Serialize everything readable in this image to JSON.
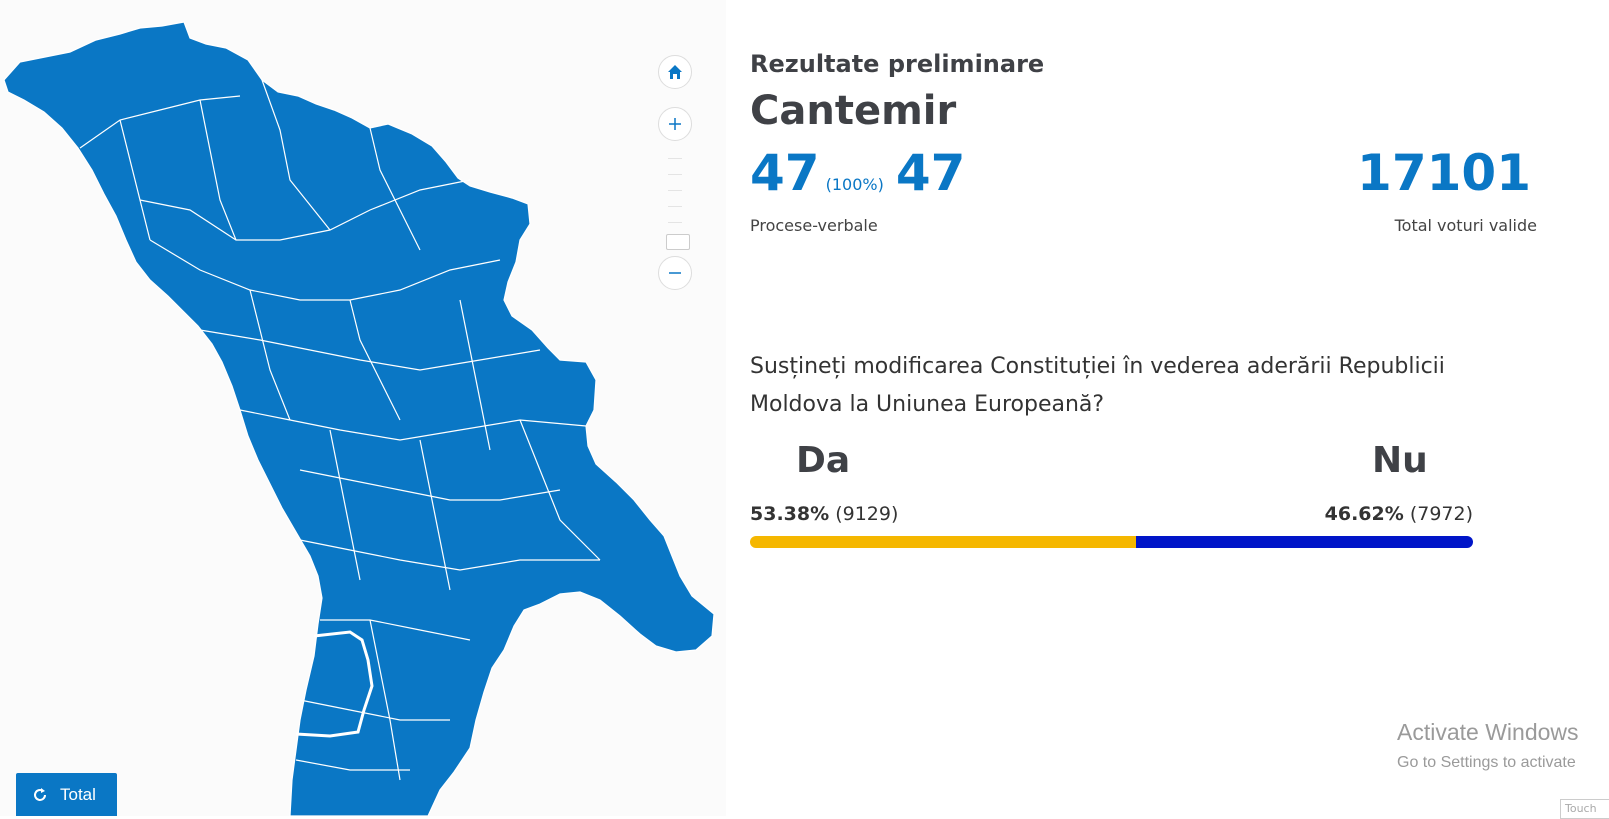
{
  "header": {
    "subtitle": "Rezultate preliminare",
    "district": "Cantemir"
  },
  "protocols": {
    "received": "47",
    "percent": "(100%)",
    "total": "47",
    "label": "Procese-verbale"
  },
  "valid_votes": {
    "value": "17101",
    "label": "Total voturi valide"
  },
  "question": "Susțineți modificarea Constituției în vederea aderării Republicii Moldova la Uniunea Europeană?",
  "answers": {
    "da": {
      "title": "Da",
      "percent_text": "53.38%",
      "count_text": "(9129)",
      "share": 53.38,
      "color": "#f5b700"
    },
    "nu": {
      "title": "Nu",
      "percent_text": "46.62%",
      "count_text": "(7972)",
      "share": 46.62,
      "color": "#0015c8"
    }
  },
  "map": {
    "fill_color": "#0a77c5",
    "border_color": "#ffffff",
    "controls": {
      "home_icon": "home-icon",
      "zoom_in_icon": "plus-icon",
      "zoom_out_icon": "minus-icon"
    }
  },
  "total_button": {
    "label": "Total",
    "icon": "refresh-icon"
  },
  "os_watermark": {
    "line1": "Activate Windows",
    "line2": "Go to Settings to activate",
    "touch": "Touch"
  }
}
